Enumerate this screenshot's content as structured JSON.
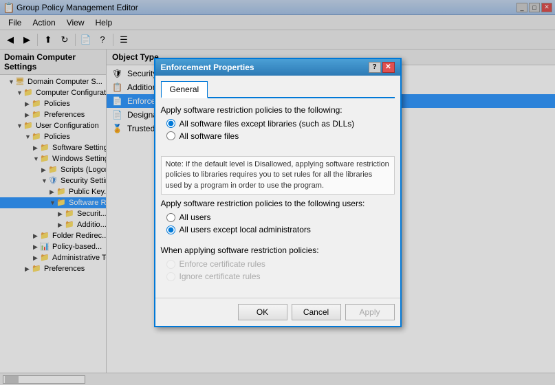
{
  "titleBar": {
    "title": "Group Policy Management Editor",
    "icon": "gp-icon"
  },
  "menuBar": {
    "items": [
      "File",
      "Action",
      "View",
      "Help"
    ]
  },
  "treePanel": {
    "header": "Domain Computer Settings",
    "nodes": [
      {
        "id": "domain",
        "label": "Domain Computer Settings",
        "indent": 0,
        "expanded": true,
        "icon": "computer"
      },
      {
        "id": "comp-config",
        "label": "Computer Configurati...",
        "indent": 1,
        "expanded": true,
        "icon": "folder"
      },
      {
        "id": "policies",
        "label": "Policies",
        "indent": 2,
        "expanded": false,
        "icon": "folder"
      },
      {
        "id": "preferences",
        "label": "Preferences",
        "indent": 2,
        "expanded": false,
        "icon": "folder"
      },
      {
        "id": "user-config",
        "label": "User Configuration",
        "indent": 1,
        "expanded": true,
        "icon": "folder"
      },
      {
        "id": "user-policies",
        "label": "Policies",
        "indent": 2,
        "expanded": true,
        "icon": "folder"
      },
      {
        "id": "software-settings",
        "label": "Software Settings",
        "indent": 3,
        "expanded": false,
        "icon": "folder"
      },
      {
        "id": "windows-settings",
        "label": "Windows Settings",
        "indent": 3,
        "expanded": true,
        "icon": "folder"
      },
      {
        "id": "scripts",
        "label": "Scripts (Logon...",
        "indent": 4,
        "expanded": false,
        "icon": "folder"
      },
      {
        "id": "security-settings",
        "label": "Security Settin...",
        "indent": 4,
        "expanded": true,
        "icon": "shield"
      },
      {
        "id": "public-key",
        "label": "Public Key...",
        "indent": 5,
        "expanded": false,
        "icon": "folder"
      },
      {
        "id": "software-r",
        "label": "Software R...",
        "indent": 5,
        "expanded": true,
        "icon": "folder"
      },
      {
        "id": "security-s",
        "label": "Securit...",
        "indent": 6,
        "expanded": false,
        "icon": "folder"
      },
      {
        "id": "addition",
        "label": "Additio...",
        "indent": 6,
        "expanded": false,
        "icon": "folder"
      },
      {
        "id": "folder-redirect",
        "label": "Folder Redirec...",
        "indent": 3,
        "expanded": false,
        "icon": "folder"
      },
      {
        "id": "policy-based",
        "label": "Policy-based...",
        "indent": 3,
        "expanded": false,
        "icon": "chart"
      },
      {
        "id": "admin-te",
        "label": "Administrative Te...",
        "indent": 3,
        "expanded": false,
        "icon": "folder"
      },
      {
        "id": "user-preferences",
        "label": "Preferences",
        "indent": 2,
        "expanded": false,
        "icon": "folder"
      }
    ]
  },
  "rightPanel": {
    "header": "Object Type",
    "items": [
      {
        "id": "security-levels",
        "label": "Security Levels",
        "icon": "shield"
      },
      {
        "id": "additional-rules",
        "label": "Additional Rules",
        "icon": "rules"
      },
      {
        "id": "enforcement",
        "label": "Enforcement",
        "icon": "enforcement",
        "selected": true
      },
      {
        "id": "designated-file-types",
        "label": "Designated File Types",
        "icon": "filetypes"
      },
      {
        "id": "trusted-publishers",
        "label": "Trusted Publishers",
        "icon": "cert"
      }
    ]
  },
  "modal": {
    "title": "Enforcement Properties",
    "tabs": [
      "General"
    ],
    "activeTab": "General",
    "section1": {
      "label": "Apply software restriction policies to the following:",
      "options": [
        {
          "id": "r1",
          "label": "All software files except libraries (such as DLLs)",
          "checked": true
        },
        {
          "id": "r2",
          "label": "All software files",
          "checked": false
        }
      ]
    },
    "note": "Note:  If the default level is Disallowed, applying software restriction policies to libraries requires you to set rules for all the libraries used by a program in order to use the program.",
    "section2": {
      "label": "Apply software restriction policies to the following users:",
      "options": [
        {
          "id": "r3",
          "label": "All users",
          "checked": false
        },
        {
          "id": "r4",
          "label": "All users except local administrators",
          "checked": true
        }
      ]
    },
    "section3": {
      "label": "When applying software restriction policies:",
      "options": [
        {
          "id": "r5",
          "label": "Enforce certificate rules",
          "checked": false,
          "disabled": true
        },
        {
          "id": "r6",
          "label": "Ignore certificate rules",
          "checked": false,
          "disabled": true
        }
      ]
    },
    "buttons": {
      "ok": "OK",
      "cancel": "Cancel",
      "apply": "Apply"
    }
  },
  "statusBar": {
    "text": ""
  }
}
